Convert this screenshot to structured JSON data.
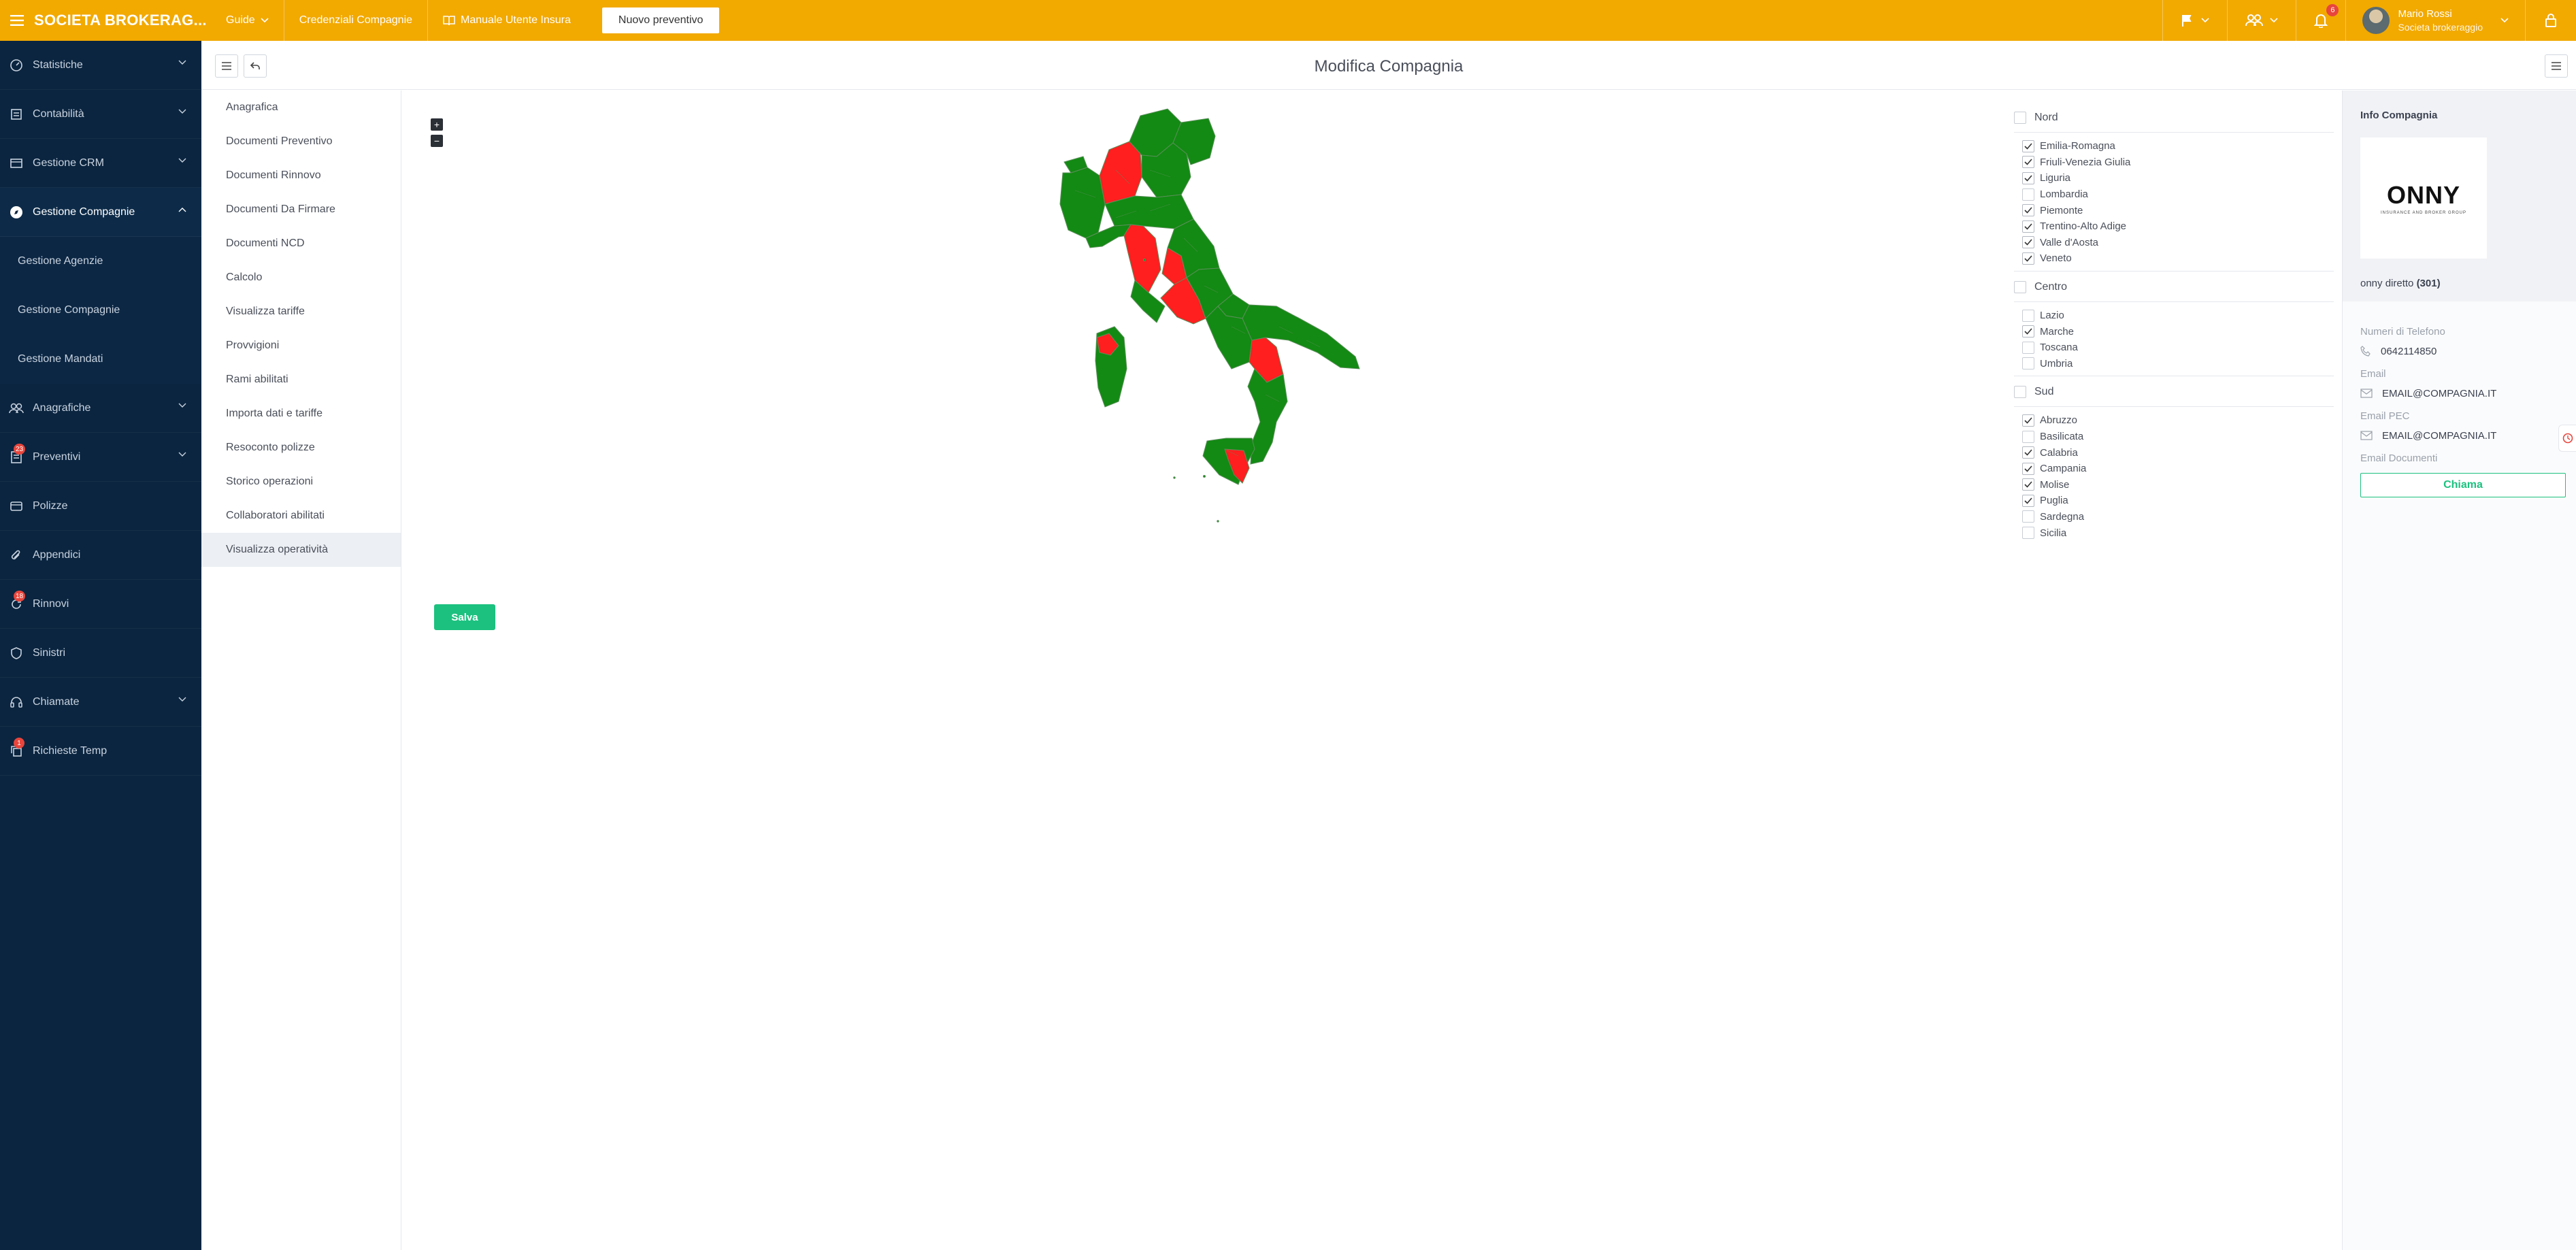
{
  "topbar": {
    "brand": "SOCIETA BROKERAG...",
    "nav": [
      {
        "label": "Guide",
        "icon": "chevron-down-icon"
      },
      {
        "label": "Credenziali Compagnie"
      },
      {
        "label": "Manuale Utente Insura",
        "icon": "book-icon"
      }
    ],
    "new_quote_label": "Nuovo preventivo",
    "notifications_count": "6",
    "user": {
      "name": "Mario Rossi",
      "role": "Societa brokeraggio"
    }
  },
  "sidebar": {
    "items": [
      {
        "label": "Statistiche",
        "icon": "gauge-icon",
        "chevron": true
      },
      {
        "label": "Contabilità",
        "icon": "ledger-icon",
        "chevron": true
      },
      {
        "label": "Gestione CRM",
        "icon": "crm-icon",
        "chevron": true
      },
      {
        "label": "Gestione Compagnie",
        "icon": "compass-icon",
        "chevron": true,
        "active": true
      },
      {
        "label": "Anagrafiche",
        "icon": "users-icon",
        "chevron": true
      },
      {
        "label": "Preventivi",
        "icon": "quote-icon",
        "chevron": true,
        "badge": "23"
      },
      {
        "label": "Polizze",
        "icon": "wallet-icon"
      },
      {
        "label": "Appendici",
        "icon": "paperclip-icon"
      },
      {
        "label": "Rinnovi",
        "icon": "refresh-icon",
        "badge": "18"
      },
      {
        "label": "Sinistri",
        "icon": "shield-icon"
      },
      {
        "label": "Chiamate",
        "icon": "headset-icon",
        "chevron": true
      },
      {
        "label": "Richieste Temp",
        "icon": "copy-icon",
        "badge": "1"
      }
    ],
    "subitems": [
      "Gestione Agenzie",
      "Gestione Compagnie",
      "Gestione Mandati"
    ]
  },
  "header": {
    "title": "Modifica Compagnia"
  },
  "menu": {
    "items": [
      "Anagrafica",
      "Documenti Preventivo",
      "Documenti Rinnovo",
      "Documenti Da Firmare",
      "Documenti NCD",
      "Calcolo",
      "Visualizza tariffe",
      "Provvigioni",
      "Rami abilitati",
      "Importa dati e tariffe",
      "Resoconto polizze",
      "Storico operazioni",
      "Collaboratori abilitati",
      "Visualizza operatività"
    ],
    "active_index": 13
  },
  "map": {
    "zoom_in": "+",
    "zoom_out": "−",
    "colors": {
      "enabled": "#138a13",
      "disabled": "#ff1f1f",
      "border": "#5a8f5a"
    }
  },
  "save_label": "Salva",
  "regions": {
    "groups": [
      {
        "name": "Nord",
        "checked": false,
        "regions": [
          {
            "name": "Emilia-Romagna",
            "checked": true
          },
          {
            "name": "Friuli-Venezia Giulia",
            "checked": true
          },
          {
            "name": "Liguria",
            "checked": true
          },
          {
            "name": "Lombardia",
            "checked": false
          },
          {
            "name": "Piemonte",
            "checked": true
          },
          {
            "name": "Trentino-Alto Adige",
            "checked": true
          },
          {
            "name": "Valle d'Aosta",
            "checked": true
          },
          {
            "name": "Veneto",
            "checked": true
          }
        ]
      },
      {
        "name": "Centro",
        "checked": false,
        "regions": [
          {
            "name": "Lazio",
            "checked": false
          },
          {
            "name": "Marche",
            "checked": true
          },
          {
            "name": "Toscana",
            "checked": false
          },
          {
            "name": "Umbria",
            "checked": false
          }
        ]
      },
      {
        "name": "Sud",
        "checked": false,
        "regions": [
          {
            "name": "Abruzzo",
            "checked": true
          },
          {
            "name": "Basilicata",
            "checked": false
          },
          {
            "name": "Calabria",
            "checked": true
          },
          {
            "name": "Campania",
            "checked": true
          },
          {
            "name": "Molise",
            "checked": true
          },
          {
            "name": "Puglia",
            "checked": true
          },
          {
            "name": "Sardegna",
            "checked": false
          },
          {
            "name": "Sicilia",
            "checked": false
          }
        ]
      }
    ]
  },
  "info": {
    "title": "Info Compagnia",
    "logo_text": "ONNY",
    "logo_sub": "INSURANCE AND BROKER GROUP",
    "company_name": "onny diretto",
    "company_code": "(301)",
    "phone_label": "Numeri di Telefono",
    "phone": "0642114850",
    "email_label": "Email",
    "email": "EMAIL@COMPAGNIA.IT",
    "pec_label": "Email PEC",
    "pec": "EMAIL@COMPAGNIA.IT",
    "docs_label": "Email Documenti",
    "call_label": "Chiama"
  },
  "colors": {
    "accent": "#f2a900",
    "sidebar": "#0b2540",
    "success": "#1cc17f",
    "badge": "#e8453c"
  }
}
